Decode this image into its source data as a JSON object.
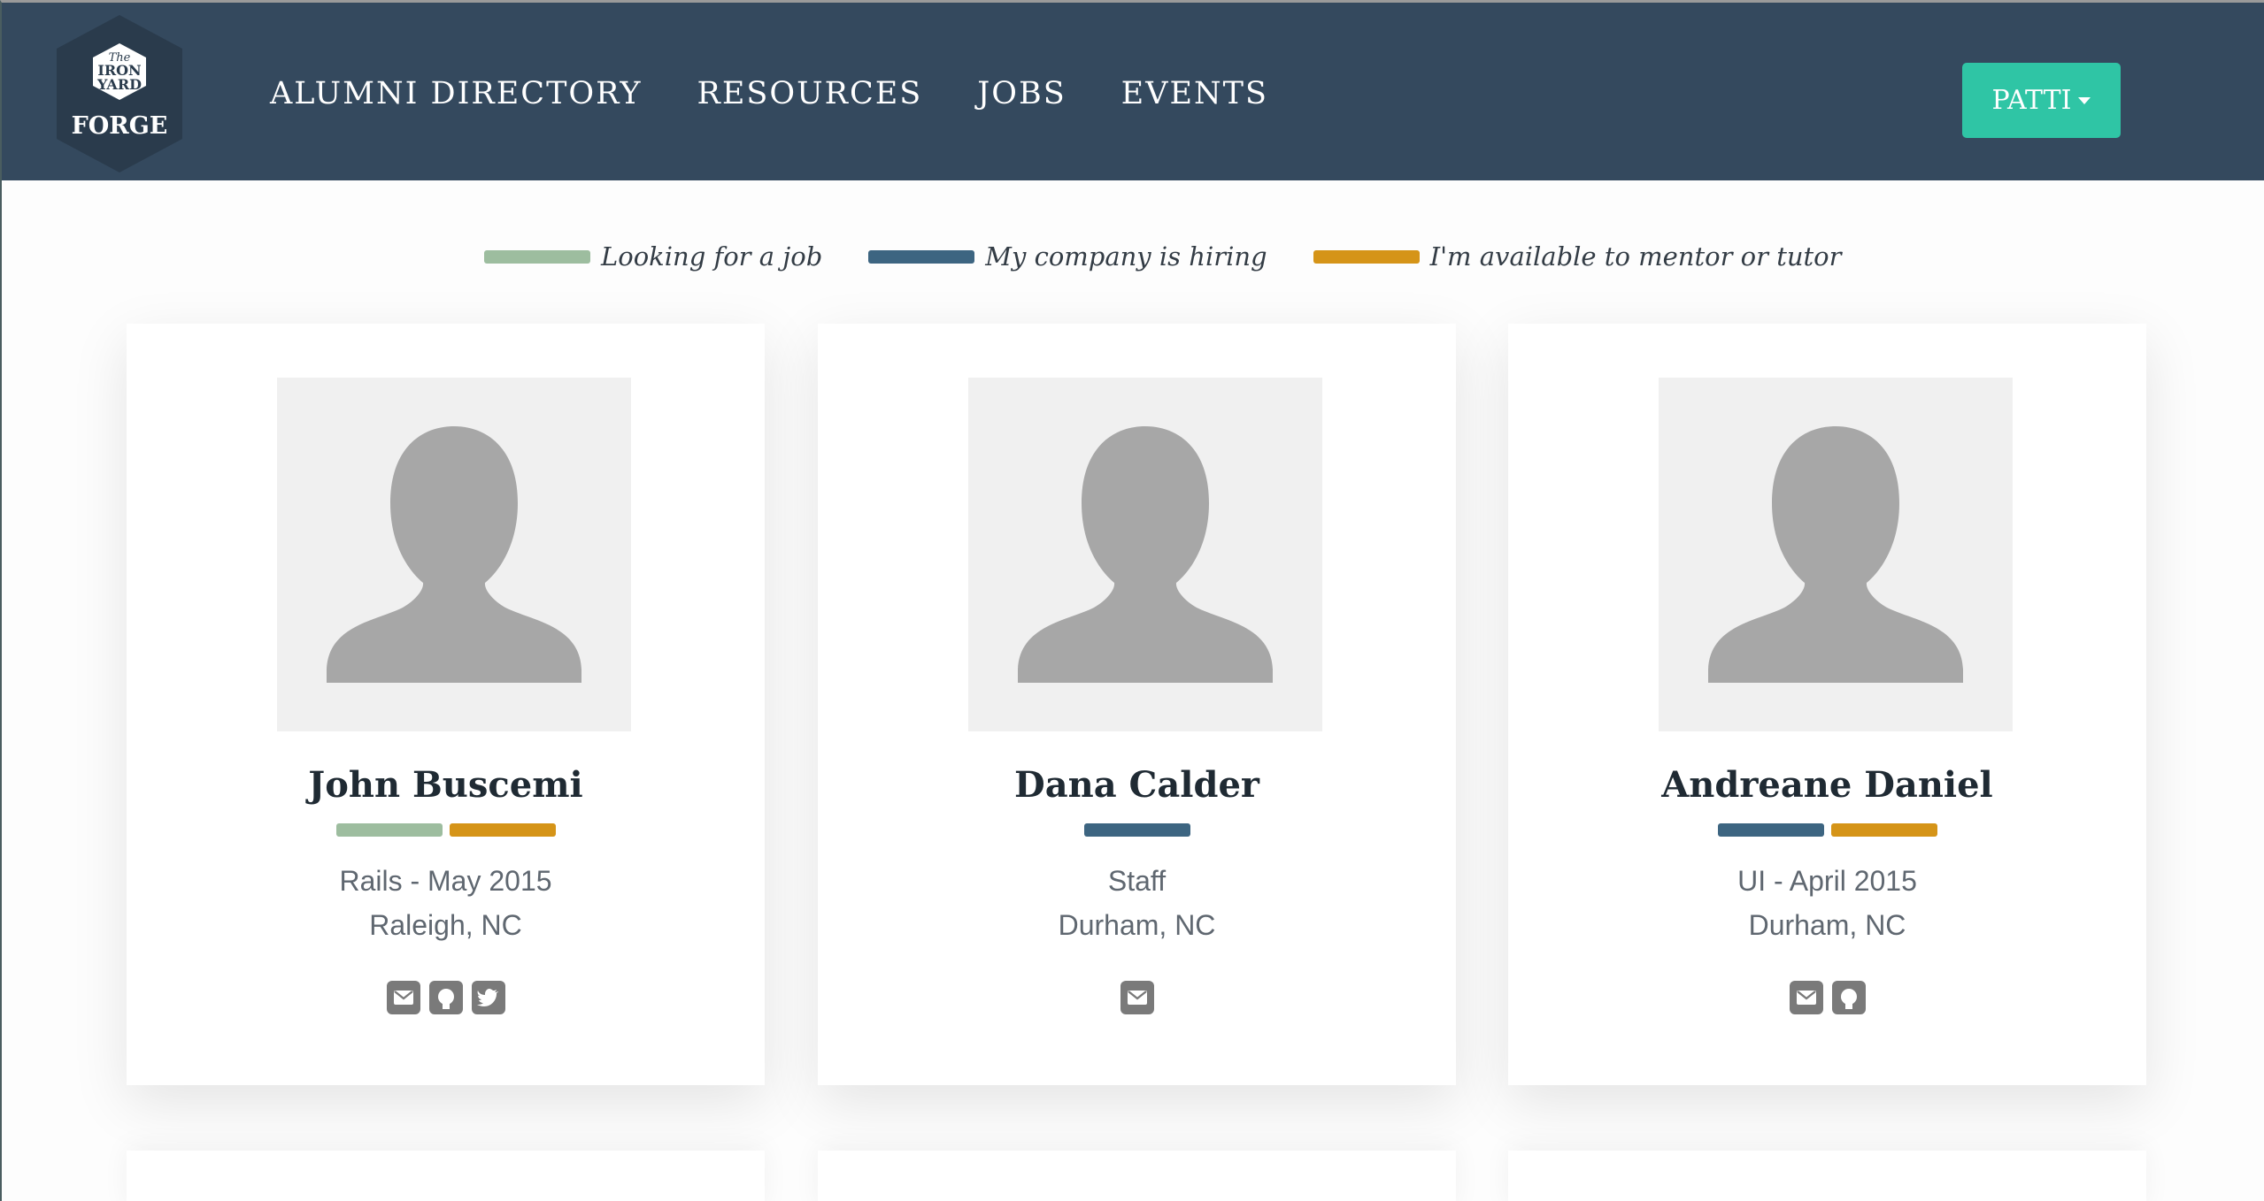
{
  "brand": {
    "logo_line1": "The",
    "logo_line2": "IRON",
    "logo_line3": "YARD",
    "logo_line4": "FORGE"
  },
  "nav": {
    "items": [
      {
        "label": "ALUMNI DIRECTORY"
      },
      {
        "label": "RESOURCES"
      },
      {
        "label": "JOBS"
      },
      {
        "label": "EVENTS"
      }
    ],
    "user_label": "PATTI"
  },
  "colors": {
    "header": "#34495e",
    "accent": "#2fc5a5",
    "looking": "#9dbd9f",
    "hiring": "#3d6581",
    "mentor": "#d59418"
  },
  "legend": [
    {
      "label": "Looking for a job",
      "color": "#9dbd9f"
    },
    {
      "label": "My company is hiring",
      "color": "#3d6581"
    },
    {
      "label": "I'm available to mentor or tutor",
      "color": "#d59418"
    }
  ],
  "alumni": [
    {
      "name": "John Buscemi",
      "statuses": [
        "#9dbd9f",
        "#d59418"
      ],
      "line1": "Rails - May 2015",
      "line2": "Raleigh, NC",
      "icons": [
        "email-icon",
        "github-icon",
        "twitter-icon"
      ]
    },
    {
      "name": "Dana Calder",
      "statuses": [
        "#3d6581"
      ],
      "line1": "Staff",
      "line2": "Durham, NC",
      "icons": [
        "email-icon"
      ]
    },
    {
      "name": "Andreane Daniel",
      "statuses": [
        "#3d6581",
        "#d59418"
      ],
      "line1": "UI - April 2015",
      "line2": "Durham, NC",
      "icons": [
        "email-icon",
        "github-icon"
      ]
    }
  ]
}
